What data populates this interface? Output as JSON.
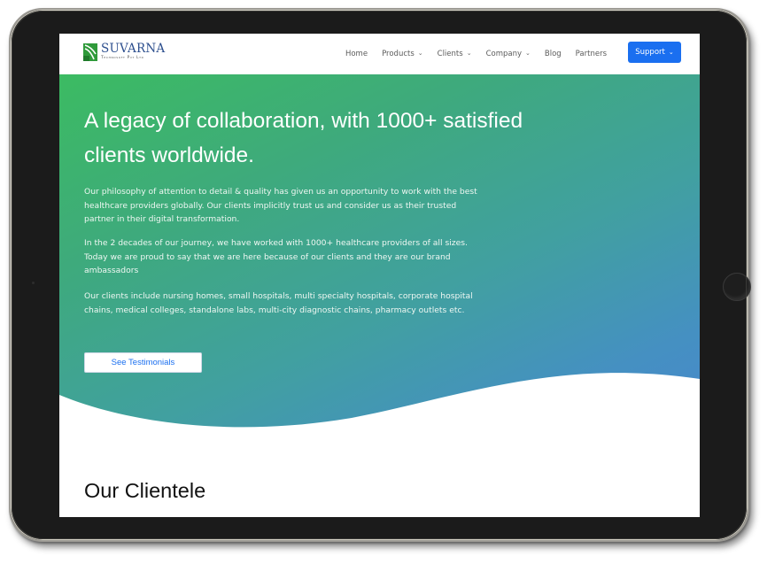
{
  "brand": {
    "name": "SUVARNA",
    "tagline": "Technosoft Pvt Ltd",
    "colors": {
      "green": "#2f9a3a",
      "navy": "#2d4f8e"
    }
  },
  "nav": {
    "items": [
      {
        "label": "Home",
        "has_dropdown": false
      },
      {
        "label": "Products",
        "has_dropdown": true
      },
      {
        "label": "Clients",
        "has_dropdown": true
      },
      {
        "label": "Company",
        "has_dropdown": true
      },
      {
        "label": "Blog",
        "has_dropdown": false
      },
      {
        "label": "Partners",
        "has_dropdown": false
      }
    ],
    "chevron_icon": "chevron-down-icon",
    "support": {
      "label": "Support",
      "color": "#1a6ff0"
    }
  },
  "hero": {
    "title": "A legacy of collaboration, with 1000+ satisfied clients worldwide.",
    "paragraphs": [
      "Our philosophy of attention to detail & quality has given us an opportunity to work with the best healthcare providers globally. Our clients implicitly trust us and consider us as their trusted partner in their digital transformation.",
      "In the 2 decades of our journey, we have worked with 1000+ healthcare providers of all sizes. Today we are proud to say that we are here because of our clients and they are our brand ambassadors",
      "Our clients include nursing homes, small hospitals, multi specialty hospitals, corporate hospital chains, medical colleges, standalone labs, multi-city diagnostic chains, pharmacy outlets etc."
    ],
    "cta_label": "See Testimonials",
    "gradient": {
      "start": "#3cbb62",
      "end": "#4788cc"
    }
  },
  "clientele": {
    "title": "Our Clientele"
  },
  "device": {
    "frame_color": "#1b1b1b"
  }
}
